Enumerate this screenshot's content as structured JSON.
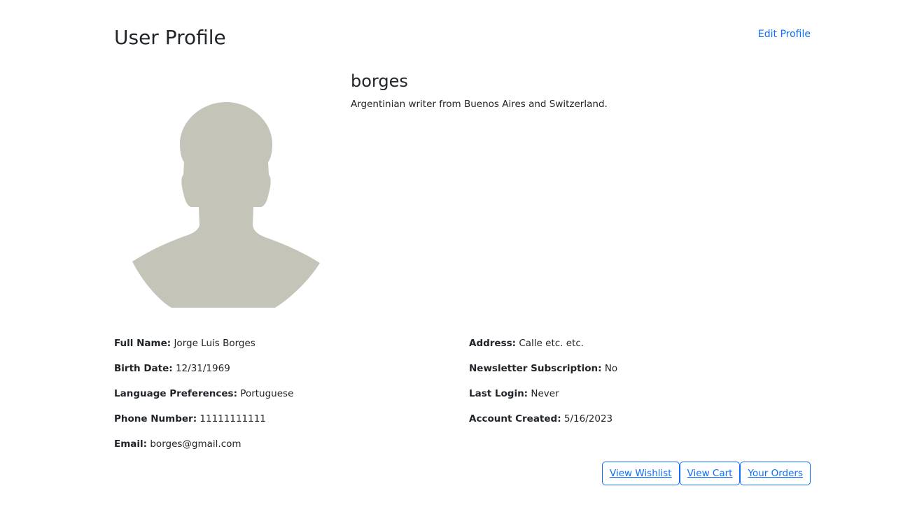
{
  "header": {
    "title": "User Profile",
    "edit_link": "Edit Profile"
  },
  "profile": {
    "username": "borges",
    "bio": "Argentinian writer from Buenos Aires and Switzerland.",
    "avatar_icon": "person-silhouette-icon",
    "avatar_color": "#c4c4b8"
  },
  "details_left": [
    {
      "label": "Full Name:",
      "value": "Jorge Luis Borges"
    },
    {
      "label": "Birth Date:",
      "value": "12/31/1969"
    },
    {
      "label": "Language Preferences:",
      "value": "Portuguese"
    },
    {
      "label": "Phone Number:",
      "value": "11111111111"
    },
    {
      "label": "Email:",
      "value": "borges@gmail.com"
    }
  ],
  "details_right": [
    {
      "label": "Address:",
      "value": "Calle etc. etc."
    },
    {
      "label": "Newsletter Subscription:",
      "value": "No"
    },
    {
      "label": "Last Login:",
      "value": "Never"
    },
    {
      "label": "Account Created:",
      "value": "5/16/2023"
    }
  ],
  "actions": {
    "wishlist": "View Wishlist",
    "cart": "View Cart",
    "orders": "Your Orders"
  },
  "colors": {
    "accent": "#0d6efd",
    "text": "#212529"
  }
}
